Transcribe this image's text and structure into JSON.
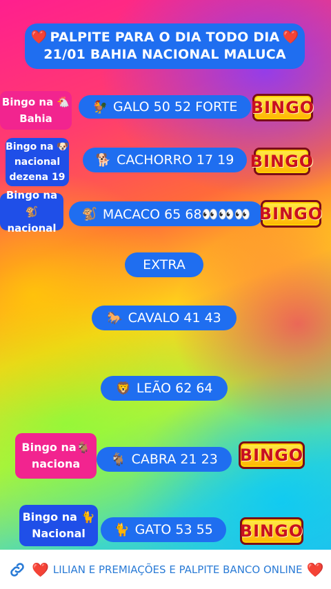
{
  "title": {
    "line1": "PALPITE PARA O DIA TODO DIA",
    "line2": "21/01 BAHIA NACIONAL  MALUCA",
    "heart": "❤️"
  },
  "rows": [
    {
      "tag_line1": "Bingo na 🐔",
      "tag_line2": "Bahia",
      "emoji": "🐓",
      "text": "GALO 50 52  FORTE",
      "bingo": "BINGO"
    },
    {
      "tag_line1": "Bingo na 🐶",
      "tag_line2": "nacional",
      "tag_line3": "dezena 19",
      "emoji": "🐕",
      "text": "CACHORRO 17 19",
      "bingo": "BINGO"
    },
    {
      "tag_line1": "Bingo na 🐒",
      "tag_line2": "nacional",
      "emoji": "🐒",
      "text": "MACACO 65 68👀👀👀",
      "bingo": "BINGO"
    },
    {
      "emoji": "🐎",
      "text": "CAVALO 41 43"
    },
    {
      "emoji": "🦁",
      "text": "LEÃO 62 64"
    },
    {
      "tag_line1": "Bingo na🐐",
      "tag_line2": "naciona",
      "emoji": "🐐",
      "text": "CABRA 21 23",
      "bingo": "BINGO"
    },
    {
      "tag_line1": "Bingo na 🐈",
      "tag_line2": "Nacional",
      "emoji": "🐈",
      "text": "GATO 53 55",
      "bingo": "BINGO"
    }
  ],
  "extra_label": "EXTRA",
  "footer": {
    "icon": "link-icon",
    "heart": "❤️",
    "text": "LILIAN E PREMIAÇÕES E PALPITE BANCO ONLINE"
  }
}
